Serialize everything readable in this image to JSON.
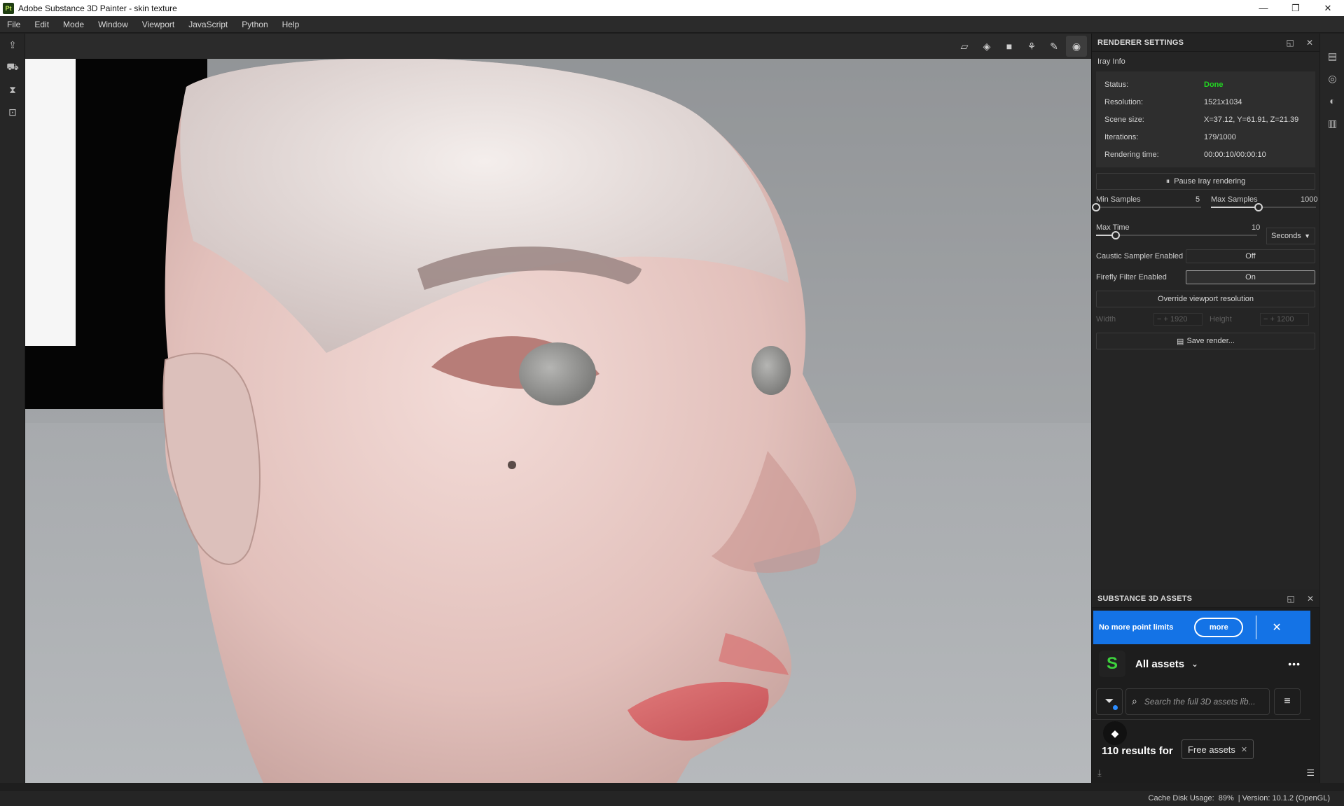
{
  "window": {
    "app_badge": "Pt",
    "title": "Adobe Substance 3D Painter - skin texture",
    "controls": {
      "minimize": "—",
      "restore": "❐",
      "close": "✕"
    }
  },
  "menu": [
    "File",
    "Edit",
    "Mode",
    "Window",
    "Viewport",
    "JavaScript",
    "Python",
    "Help"
  ],
  "renderer": {
    "title": "RENDERER SETTINGS",
    "section": "Iray Info",
    "info": [
      {
        "key": "Status:",
        "value": "Done"
      },
      {
        "key": "Resolution:",
        "value": "1521x1034"
      },
      {
        "key": "Scene size:",
        "value": "X=37.12, Y=61.91, Z=21.39"
      },
      {
        "key": "Iterations:",
        "value": "179/1000"
      },
      {
        "key": "Rendering time:",
        "value": "00:00:10/00:00:10"
      }
    ],
    "pause_label": "Pause Iray rendering",
    "min_samples": {
      "label": "Min Samples",
      "value": "5",
      "fraction": 0.0
    },
    "max_samples": {
      "label": "Max Samples",
      "value": "1000",
      "fraction": 0.45
    },
    "max_time": {
      "label": "Max Time",
      "value": "10",
      "fraction": 0.12,
      "unit": "Seconds"
    },
    "caustic": {
      "label": "Caustic Sampler Enabled",
      "value": "Off"
    },
    "firefly": {
      "label": "Firefly Filter Enabled",
      "value": "On"
    },
    "override_label": "Override viewport resolution",
    "width": {
      "label": "Width",
      "value": "1920"
    },
    "height": {
      "label": "Height",
      "value": "1200"
    },
    "save_label": "Save render..."
  },
  "assets": {
    "title": "SUBSTANCE 3D ASSETS",
    "promo_text": "No more point limits",
    "promo_button": "more",
    "library": "All assets",
    "search_placeholder": "Search the full 3D assets lib...",
    "results_text": "110 results for",
    "filter_chip": "Free assets"
  },
  "status": {
    "cache_label": "Cache Disk Usage:",
    "cache_value": "89%",
    "version": "| Version: 10.1.2 (OpenGL)"
  },
  "colors": {
    "accent_blue": "#1473e6",
    "status_done": "#22d422",
    "substance_green": "#3dd13d"
  }
}
